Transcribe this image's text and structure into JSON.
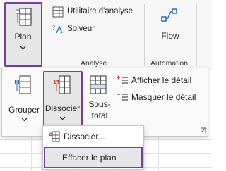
{
  "ribbon": {
    "plan_label": "Plan",
    "utilitaire_label": "Utilitaire d'analyse",
    "solveur_label": "Solveur",
    "analyse_group": "Analyse",
    "flow_label": "Flow",
    "automation_group": "Automation"
  },
  "plan_panel": {
    "grouper_label": "Grouper",
    "dissocier_label": "Dissocier",
    "soustotal_label_1": "Sous-",
    "soustotal_label_2": "total",
    "afficher_label": "Afficher le détail",
    "masquer_label": "Masquer le détail"
  },
  "dropdown": {
    "item_dissocier": "Dissocier...",
    "item_effacer": "Effacer le plan"
  },
  "colors": {
    "highlight": "#7a3e9a",
    "selected_bg": "#e6e6e6",
    "accent_blue": "#2b6cb0",
    "accent_red": "#d83b3b"
  }
}
